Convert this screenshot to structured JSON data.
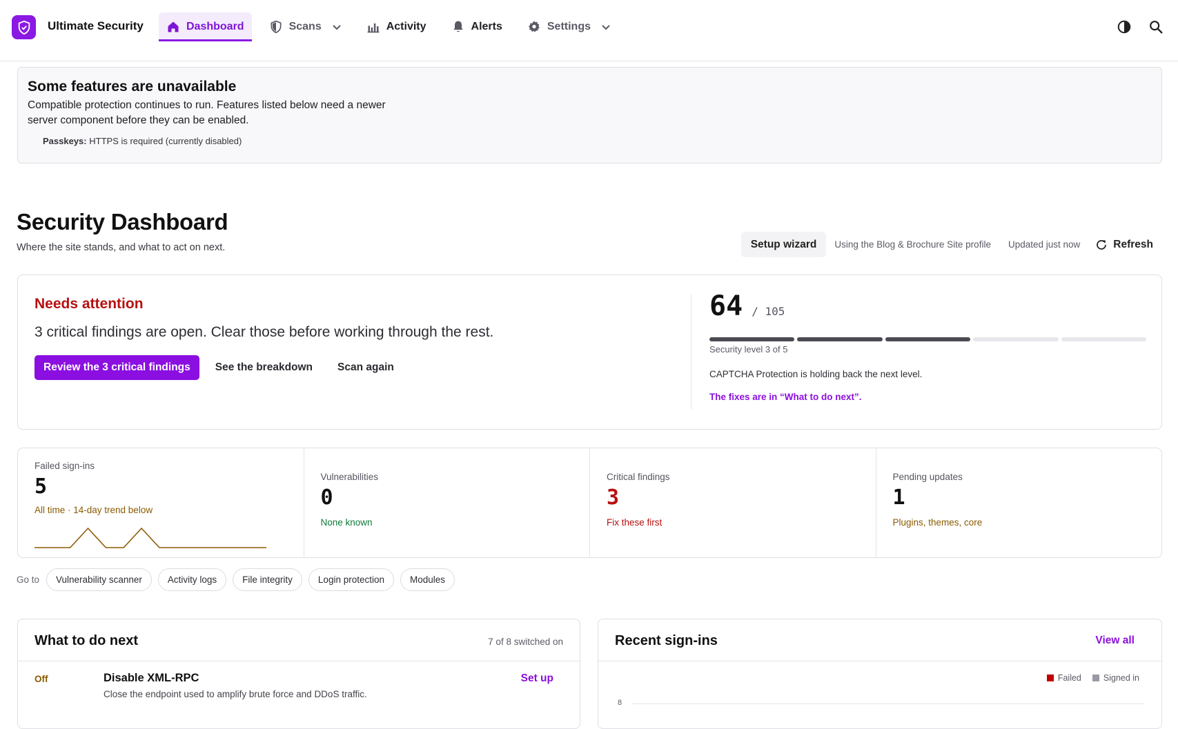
{
  "app": {
    "name": "Ultimate Security"
  },
  "nav": {
    "items": [
      {
        "label": "Dashboard",
        "icon": "home-icon",
        "active": true
      },
      {
        "label": "Scans",
        "icon": "shield-icon",
        "dropdown": true
      },
      {
        "label": "Activity",
        "icon": "bar-chart-icon"
      },
      {
        "label": "Alerts",
        "icon": "bell-icon"
      },
      {
        "label": "Settings",
        "icon": "gear-icon",
        "dropdown": true
      }
    ],
    "right_icons": [
      "theme-toggle-icon",
      "search-icon"
    ]
  },
  "notice": {
    "title": "Some features are unavailable",
    "body": "Compatible protection continues to run. Features listed below need a newer server component before they can be enabled.",
    "item_name": "Passkeys:",
    "item_text": "HTTPS is required (currently disabled)"
  },
  "header": {
    "title": "Security Dashboard",
    "subtitle": "Where the site stands, and what to act on next.",
    "wizard_label": "Setup wizard",
    "profile_text": "Using the Blog & Brochure Site profile",
    "updated_text": "Updated just now",
    "refresh_label": "Refresh"
  },
  "status": {
    "heading": "Needs attention",
    "message": "3 critical findings are open. Clear those before working through the rest.",
    "primary_action": "Review the 3 critical findings",
    "breakdown_action": "See the breakdown",
    "scan_action": "Scan again",
    "score": "64",
    "score_max": "/ 105",
    "level_current": 3,
    "level_total": 5,
    "level_label": "Security level 3 of 5",
    "hold_text": "CAPTCHA Protection is holding back the next level.",
    "fix_link": "The fixes are in “What to do next”."
  },
  "stats": [
    {
      "label": "Failed sign-ins",
      "value": "5",
      "note": "All time · 14-day trend below",
      "color": "#8a5a00",
      "trend": [
        0,
        0,
        0,
        1,
        0,
        0,
        1,
        0,
        0,
        0,
        0,
        0,
        0,
        0
      ]
    },
    {
      "label": "Vulnerabilities",
      "value": "0",
      "note": "None known",
      "color": "#0f7a3a"
    },
    {
      "label": "Critical findings",
      "value": "3",
      "note": "Fix these first",
      "color": "#b81010"
    },
    {
      "label": "Pending updates",
      "value": "1",
      "note": "Plugins, themes, core",
      "color": "#8a5a00"
    }
  ],
  "goto": {
    "label": "Go to",
    "chips": [
      "Vulnerability scanner",
      "Activity logs",
      "File integrity",
      "Login protection",
      "Modules"
    ]
  },
  "todo": {
    "title": "What to do next",
    "meta": "7 of 8 switched on",
    "item_status": "Off",
    "item_title": "Disable XML-RPC",
    "item_desc": "Close the endpoint used to amplify brute force and DDoS traffic.",
    "item_action": "Set up"
  },
  "signins": {
    "title": "Recent sign-ins",
    "view_all": "View all",
    "legend_failed": "Failed",
    "legend_signed": "Signed in",
    "failed_color": "#c00000",
    "signed_color": "#9a9aa6",
    "axis_tick": "8"
  },
  "colors": {
    "accent": "#8b19e4",
    "danger": "#b81010",
    "warning": "#8a5a00",
    "success": "#0f7a3a"
  }
}
